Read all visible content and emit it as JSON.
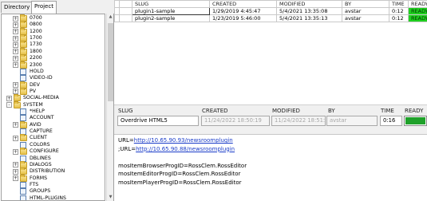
{
  "tabs": [
    {
      "label": "Directory",
      "active": false
    },
    {
      "label": "Project",
      "active": true
    }
  ],
  "tree": [
    {
      "label": "0700",
      "type": "folder",
      "expander": "+",
      "depth": 1
    },
    {
      "label": "0800",
      "type": "folder",
      "expander": "+",
      "depth": 1
    },
    {
      "label": "1200",
      "type": "folder",
      "expander": "+",
      "depth": 1
    },
    {
      "label": "1700",
      "type": "folder",
      "expander": "+",
      "depth": 1
    },
    {
      "label": "1730",
      "type": "folder",
      "expander": "+",
      "depth": 1
    },
    {
      "label": "1800",
      "type": "folder",
      "expander": "+",
      "depth": 1
    },
    {
      "label": "2200",
      "type": "folder",
      "expander": "+",
      "depth": 1
    },
    {
      "label": "2300",
      "type": "folder",
      "expander": "+",
      "depth": 1
    },
    {
      "label": "HOLD",
      "type": "page",
      "expander": "",
      "depth": 1
    },
    {
      "label": "VIDEO-ID",
      "type": "page",
      "expander": "",
      "depth": 1
    },
    {
      "label": "DEV",
      "type": "folder",
      "expander": "+",
      "depth": 1
    },
    {
      "label": "PV",
      "type": "folder",
      "expander": "+",
      "depth": 1
    },
    {
      "label": "SOCIAL-MEDIA",
      "type": "folder",
      "expander": "+",
      "depth": 0
    },
    {
      "label": "SYSTEM",
      "type": "folder",
      "expander": "-",
      "depth": 0
    },
    {
      "label": "*HELP",
      "type": "page",
      "expander": "",
      "depth": 1
    },
    {
      "label": "ACCOUNT",
      "type": "page",
      "expander": "",
      "depth": 1
    },
    {
      "label": "AVID",
      "type": "folder",
      "expander": "+",
      "depth": 1
    },
    {
      "label": "CAPTURE",
      "type": "page",
      "expander": "",
      "depth": 1
    },
    {
      "label": "CLIENT",
      "type": "folder",
      "expander": "+",
      "depth": 1
    },
    {
      "label": "COLORS",
      "type": "page",
      "expander": "",
      "depth": 1
    },
    {
      "label": "CONFIGURE",
      "type": "folder",
      "expander": "+",
      "depth": 1
    },
    {
      "label": "DBLINES",
      "type": "page",
      "expander": "",
      "depth": 1
    },
    {
      "label": "DIALOGS",
      "type": "folder",
      "expander": "+",
      "depth": 1
    },
    {
      "label": "DISTRIBUTION",
      "type": "folder",
      "expander": "+",
      "depth": 1
    },
    {
      "label": "FORMS",
      "type": "folder",
      "expander": "+",
      "depth": 1
    },
    {
      "label": "FTS",
      "type": "page",
      "expander": "",
      "depth": 1
    },
    {
      "label": "GROUPS",
      "type": "page",
      "expander": "",
      "depth": 1
    },
    {
      "label": "HTML-PLUGINS",
      "type": "page",
      "expander": "",
      "depth": 1
    }
  ],
  "grid": {
    "headers": [
      "SLUG",
      "CREATED",
      "MODIFIED",
      "BY",
      "TIME",
      "READY"
    ],
    "rows": [
      [
        "plugin1-sample",
        "1/29/2019 4:45:47",
        "5/4/2021 13:35:08",
        "avstar",
        "0:12",
        "READY"
      ],
      [
        "plugin2-sample",
        "1/23/2019 5:46:00",
        "5/4/2021 13:35:13",
        "avstar",
        "0:12",
        "READY"
      ]
    ]
  },
  "detail": {
    "headers": [
      "SLUG",
      "CREATED",
      "MODIFIED",
      "BY",
      "TIME",
      "READY"
    ],
    "values": [
      "Overdrive HTML5",
      "11/24/2022 18:50:19",
      "11/24/2022 18:51:33",
      "avstar",
      "0:16"
    ],
    "ready_fill_percent": 100
  },
  "notes": {
    "url1_prefix": "URL=",
    "url1_link": "http://10.65.90.93/newsroomplugin",
    "url2_prefix": ";URL=",
    "url2_link": "http://10.65.90.88/newsroomplugin",
    "line3": "mosItemBrowserProgID=RossClem.RossEditor",
    "line4": "mosItemEditorProgID=RossClem.RossEditor",
    "line5": "mosItemPlayerProgID=RossClem.RossEditor"
  },
  "colors": {
    "ready_green": "#1fd11f",
    "progress_green": "#1fa12a",
    "link_blue": "#1a3cc8",
    "folder_yellow": "#e7c24a"
  }
}
